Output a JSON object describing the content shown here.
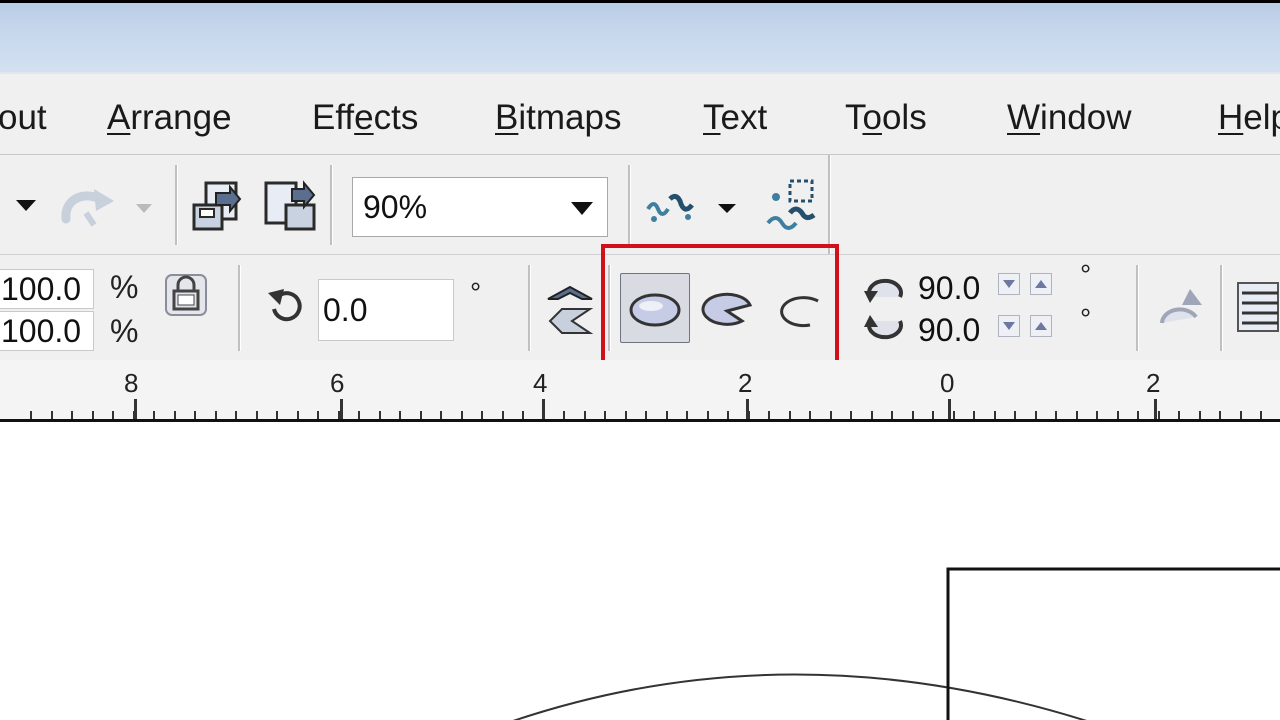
{
  "menu": {
    "items": [
      {
        "label_pre": "",
        "label_u": "",
        "label_post": "out"
      },
      {
        "label_pre": "",
        "label_u": "A",
        "label_post": "rrange"
      },
      {
        "label_pre": "Eff",
        "label_u": "e",
        "label_post": "cts"
      },
      {
        "label_pre": "",
        "label_u": "B",
        "label_post": "itmaps"
      },
      {
        "label_pre": "",
        "label_u": "T",
        "label_post": "ext"
      },
      {
        "label_pre": "T",
        "label_u": "o",
        "label_post": "ols"
      },
      {
        "label_pre": "",
        "label_u": "W",
        "label_post": "indow"
      },
      {
        "label_pre": "",
        "label_u": "H",
        "label_post": "elp"
      }
    ]
  },
  "toolbar": {
    "zoom_value": "90%",
    "icons": [
      "dropdown-arrow-icon",
      "redo-icon",
      "import-icon",
      "export-icon",
      "application-launcher-icon",
      "welcome-screen-icon"
    ]
  },
  "property_bar": {
    "scale_x": "100.0",
    "scale_y": "100.0",
    "percent": "%",
    "rotation": "0.0",
    "degree": "°",
    "start_angle": "90.0",
    "end_angle": "90.0",
    "ellipse_modes": [
      "ellipse",
      "pie",
      "arc"
    ],
    "selected_mode": "ellipse"
  },
  "ruler": {
    "labels": [
      "8",
      "6",
      "4",
      "2",
      "0",
      "2"
    ]
  },
  "colors": {
    "highlight": "#d0101a",
    "titlebar": "#c6d7ec",
    "toolbar_bg": "#f0f0f0"
  }
}
